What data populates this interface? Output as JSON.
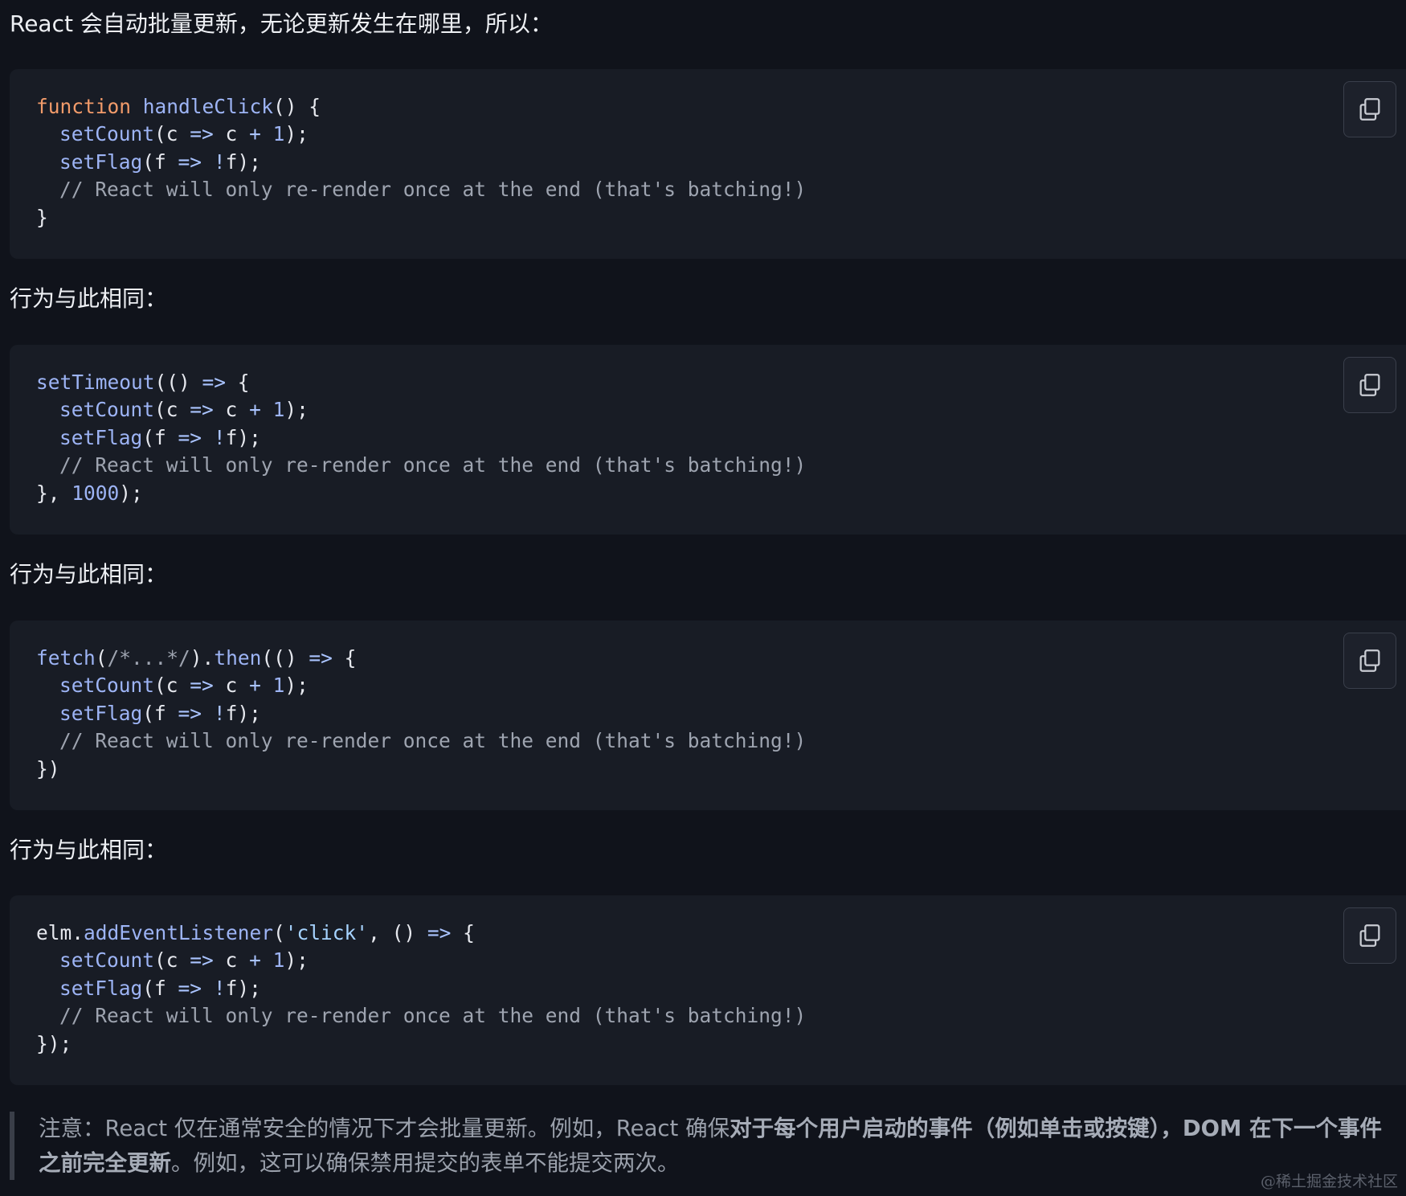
{
  "intro_text": "React 会自动批量更新，无论更新发生在哪里，所以：",
  "same_as_label": "行为与此相同：",
  "code_blocks": [
    {
      "lines": [
        [
          {
            "t": "kw",
            "v": "function"
          },
          {
            "t": "pl",
            "v": " "
          },
          {
            "t": "fn",
            "v": "handleClick"
          },
          {
            "t": "pl",
            "v": "() {"
          }
        ],
        [
          {
            "t": "fn",
            "v": "setCount",
            "i": 1
          },
          {
            "t": "pl",
            "v": "(c "
          },
          {
            "t": "op",
            "v": "=>"
          },
          {
            "t": "pl",
            "v": " c "
          },
          {
            "t": "op",
            "v": "+"
          },
          {
            "t": "pl",
            "v": " "
          },
          {
            "t": "num",
            "v": "1"
          },
          {
            "t": "pl",
            "v": ");"
          }
        ],
        [
          {
            "t": "fn",
            "v": "setFlag",
            "i": 1
          },
          {
            "t": "pl",
            "v": "(f "
          },
          {
            "t": "op",
            "v": "=>"
          },
          {
            "t": "pl",
            "v": " "
          },
          {
            "t": "op",
            "v": "!"
          },
          {
            "t": "pl",
            "v": "f);"
          }
        ],
        [
          {
            "t": "cm",
            "v": "// React will only re-render once at the end (that's batching!)",
            "i": 1
          }
        ],
        [
          {
            "t": "pl",
            "v": "}"
          }
        ]
      ]
    },
    {
      "lines": [
        [
          {
            "t": "fn",
            "v": "setTimeout"
          },
          {
            "t": "pl",
            "v": "(() "
          },
          {
            "t": "op",
            "v": "=>"
          },
          {
            "t": "pl",
            "v": " {"
          }
        ],
        [
          {
            "t": "fn",
            "v": "setCount",
            "i": 1
          },
          {
            "t": "pl",
            "v": "(c "
          },
          {
            "t": "op",
            "v": "=>"
          },
          {
            "t": "pl",
            "v": " c "
          },
          {
            "t": "op",
            "v": "+"
          },
          {
            "t": "pl",
            "v": " "
          },
          {
            "t": "num",
            "v": "1"
          },
          {
            "t": "pl",
            "v": ");"
          }
        ],
        [
          {
            "t": "fn",
            "v": "setFlag",
            "i": 1
          },
          {
            "t": "pl",
            "v": "(f "
          },
          {
            "t": "op",
            "v": "=>"
          },
          {
            "t": "pl",
            "v": " "
          },
          {
            "t": "op",
            "v": "!"
          },
          {
            "t": "pl",
            "v": "f);"
          }
        ],
        [
          {
            "t": "cm",
            "v": "// React will only re-render once at the end (that's batching!)",
            "i": 1
          }
        ],
        [
          {
            "t": "pl",
            "v": "}, "
          },
          {
            "t": "num",
            "v": "1000"
          },
          {
            "t": "pl",
            "v": ");"
          }
        ]
      ]
    },
    {
      "lines": [
        [
          {
            "t": "fn",
            "v": "fetch"
          },
          {
            "t": "pl",
            "v": "("
          },
          {
            "t": "cm",
            "v": "/*...*/"
          },
          {
            "t": "pl",
            "v": ")."
          },
          {
            "t": "fn",
            "v": "then"
          },
          {
            "t": "pl",
            "v": "(() "
          },
          {
            "t": "op",
            "v": "=>"
          },
          {
            "t": "pl",
            "v": " {"
          }
        ],
        [
          {
            "t": "fn",
            "v": "setCount",
            "i": 1
          },
          {
            "t": "pl",
            "v": "(c "
          },
          {
            "t": "op",
            "v": "=>"
          },
          {
            "t": "pl",
            "v": " c "
          },
          {
            "t": "op",
            "v": "+"
          },
          {
            "t": "pl",
            "v": " "
          },
          {
            "t": "num",
            "v": "1"
          },
          {
            "t": "pl",
            "v": ");"
          }
        ],
        [
          {
            "t": "fn",
            "v": "setFlag",
            "i": 1
          },
          {
            "t": "pl",
            "v": "(f "
          },
          {
            "t": "op",
            "v": "=>"
          },
          {
            "t": "pl",
            "v": " "
          },
          {
            "t": "op",
            "v": "!"
          },
          {
            "t": "pl",
            "v": "f);"
          }
        ],
        [
          {
            "t": "cm",
            "v": "// React will only re-render once at the end (that's batching!)",
            "i": 1
          }
        ],
        [
          {
            "t": "pl",
            "v": "})"
          }
        ]
      ]
    },
    {
      "lines": [
        [
          {
            "t": "pl",
            "v": "elm."
          },
          {
            "t": "fn",
            "v": "addEventListener"
          },
          {
            "t": "pl",
            "v": "("
          },
          {
            "t": "str",
            "v": "'click'"
          },
          {
            "t": "pl",
            "v": ", () "
          },
          {
            "t": "op",
            "v": "=>"
          },
          {
            "t": "pl",
            "v": " {"
          }
        ],
        [
          {
            "t": "fn",
            "v": "setCount",
            "i": 1
          },
          {
            "t": "pl",
            "v": "(c "
          },
          {
            "t": "op",
            "v": "=>"
          },
          {
            "t": "pl",
            "v": " c "
          },
          {
            "t": "op",
            "v": "+"
          },
          {
            "t": "pl",
            "v": " "
          },
          {
            "t": "num",
            "v": "1"
          },
          {
            "t": "pl",
            "v": ");"
          }
        ],
        [
          {
            "t": "fn",
            "v": "setFlag",
            "i": 1
          },
          {
            "t": "pl",
            "v": "(f "
          },
          {
            "t": "op",
            "v": "=>"
          },
          {
            "t": "pl",
            "v": " "
          },
          {
            "t": "op",
            "v": "!"
          },
          {
            "t": "pl",
            "v": "f);"
          }
        ],
        [
          {
            "t": "cm",
            "v": "// React will only re-render once at the end (that's batching!)",
            "i": 1
          }
        ],
        [
          {
            "t": "pl",
            "v": "});"
          }
        ]
      ]
    }
  ],
  "copy_button": {
    "icon": "copy-icon"
  },
  "note": {
    "prefix": "注意：React 仅在通常安全的情况下才会批量更新。例如，React 确保",
    "bold": "对于每个用户启动的事件（例如单击或按键），DOM 在下一个事件之前完全更新",
    "suffix": "。例如，这可以确保禁用提交的表单不能提交两次。"
  },
  "watermark": "@稀土掘金技术社区",
  "colors": {
    "background": "#10131b",
    "code_background": "#181c25",
    "keyword": "#f29b6a",
    "function": "#9db4f5",
    "comment": "#9ea4b0"
  }
}
